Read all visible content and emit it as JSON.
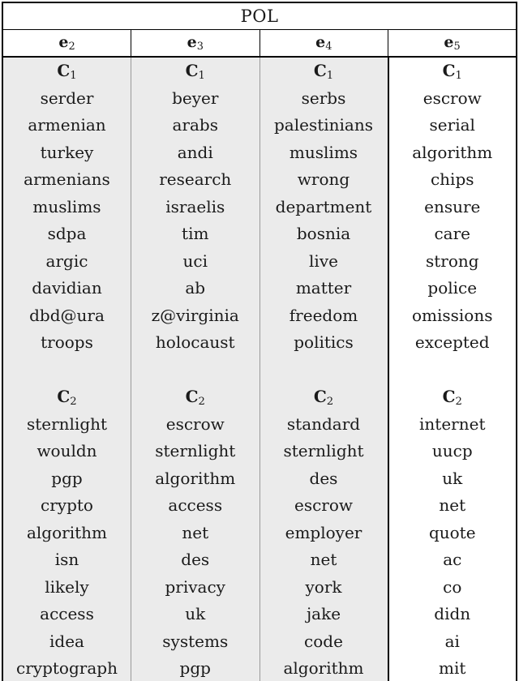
{
  "table": {
    "title": "POL",
    "columns": [
      {
        "header_base": "e",
        "header_sub": "2",
        "shaded": true,
        "clusters": [
          {
            "label_base": "C",
            "label_sub": "1",
            "terms": [
              "serder",
              "armenian",
              "turkey",
              "armenians",
              "muslims",
              "sdpa",
              "argic",
              "davidian",
              "dbd@ura",
              "troops"
            ]
          },
          {
            "label_base": "C",
            "label_sub": "2",
            "terms": [
              "sternlight",
              "wouldn",
              "pgp",
              "crypto",
              "algorithm",
              "isn",
              "likely",
              "access",
              "idea",
              "cryptograph"
            ]
          }
        ]
      },
      {
        "header_base": "e",
        "header_sub": "3",
        "shaded": true,
        "clusters": [
          {
            "label_base": "C",
            "label_sub": "1",
            "terms": [
              "beyer",
              "arabs",
              "andi",
              "research",
              "israelis",
              "tim",
              "uci",
              "ab",
              "z@virginia",
              "holocaust"
            ]
          },
          {
            "label_base": "C",
            "label_sub": "2",
            "terms": [
              "escrow",
              "sternlight",
              "algorithm",
              "access",
              "net",
              "des",
              "privacy",
              "uk",
              "systems",
              "pgp"
            ]
          }
        ]
      },
      {
        "header_base": "e",
        "header_sub": "4",
        "shaded": true,
        "clusters": [
          {
            "label_base": "C",
            "label_sub": "1",
            "terms": [
              "serbs",
              "palestinians",
              "muslims",
              "wrong",
              "department",
              "bosnia",
              "live",
              "matter",
              "freedom",
              "politics"
            ]
          },
          {
            "label_base": "C",
            "label_sub": "2",
            "terms": [
              "standard",
              "sternlight",
              "des",
              "escrow",
              "employer",
              "net",
              "york",
              "jake",
              "code",
              "algorithm"
            ]
          }
        ]
      },
      {
        "header_base": "e",
        "header_sub": "5",
        "shaded": false,
        "clusters": [
          {
            "label_base": "C",
            "label_sub": "1",
            "terms": [
              "escrow",
              "serial",
              "algorithm",
              "chips",
              "ensure",
              "care",
              "strong",
              "police",
              "omissions",
              "excepted"
            ]
          },
          {
            "label_base": "C",
            "label_sub": "2",
            "terms": [
              "internet",
              "uucp",
              "uk",
              "net",
              "quote",
              "ac",
              "co",
              "didn",
              "ai",
              "mit"
            ]
          }
        ]
      }
    ]
  },
  "colors": {
    "shaded_background": "#ebebeb",
    "plain_background": "#ffffff",
    "rule": "#000000",
    "inner_rule": "#9a9a9a",
    "text": "#1a1a1a"
  }
}
